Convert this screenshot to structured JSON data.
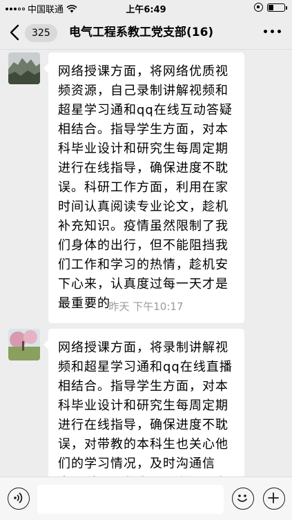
{
  "status_bar": {
    "carrier": "中国联通",
    "time": "上午6:49"
  },
  "header": {
    "unread_count": "325",
    "title": "电气工程系教工党支部(16)"
  },
  "messages": [
    {
      "text": "网络授课方面，将网络优质视频资源，自己录制讲解视频和超星学习通和qq在线互动答疑相结合。指导学生方面，对本科毕业设计和研究生每周定期进行在线指导，确保进度不耽误。科研工作方面，利用在家时间认真阅读专业论文，趁机补充知识。疫情虽然限制了我们身体的出行，但不能阻挡我们工作和学习的热情，趁机安下心来，认真度过每一天才是最重要的"
    },
    {
      "text": "网络授课方面，将录制讲解视频和超星学习通和qq在线直播相结合。指导学生方面，对本科毕业设计和研究生每周定期进行在线指导，确保进度不耽误，对带教的本科生也关心他们的学习情况，及时沟通信息。科研工作方面，利用现在疫情好转，抓紧跟企业洽谈项"
    }
  ],
  "timestamp": "昨天 下午10:17",
  "icons": {
    "back": "back-arrow-icon",
    "more": "more-dots-icon",
    "voice": "voice-icon",
    "emoji": "emoji-icon",
    "plus": "plus-icon"
  }
}
